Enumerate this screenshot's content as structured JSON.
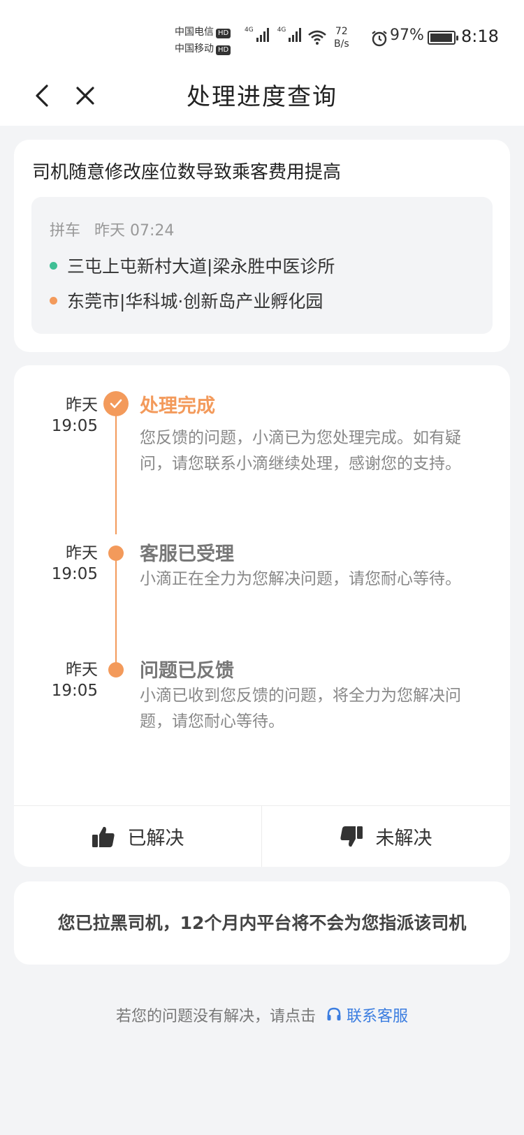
{
  "status_bar": {
    "carrier1": "中国电信",
    "carrier2": "中国移动",
    "hd": "HD",
    "network": "4G",
    "net_speed_value": "72",
    "net_speed_unit": "B/s",
    "battery_pct": "97%",
    "time": "8:18",
    "battery_level": 0.97
  },
  "nav": {
    "title": "处理进度查询",
    "back_icon": "chevron-left-icon",
    "close_icon": "close-icon"
  },
  "order": {
    "title": "司机随意修改座位数导致乘客费用提高",
    "type": "拼车",
    "time": "昨天 07:24",
    "start": "三屯上屯新村大道|梁永胜中医诊所",
    "end": "东莞市|华科城·创新岛产业孵化园",
    "start_color": "#3fbf95",
    "end_color": "#f39a5b"
  },
  "timeline": [
    {
      "day": "昨天",
      "time": "19:05",
      "title": "处理完成",
      "desc": "您反馈的问题，小滴已为您处理完成。如有疑问，请您联系小滴继续处理，感谢您的支持。"
    },
    {
      "day": "昨天",
      "time": "19:05",
      "title": "客服已受理",
      "desc": "小滴正在全力为您解决问题，请您耐心等待。"
    },
    {
      "day": "昨天",
      "time": "19:05",
      "title": "问题已反馈",
      "desc": "小滴已收到您反馈的问题，将全力为您解决问题，请您耐心等待。"
    }
  ],
  "feedback": {
    "solved_label": "已解决",
    "unsolved_label": "未解决"
  },
  "notice": {
    "text": "您已拉黑司机，12个月内平台将不会为您指派该司机"
  },
  "footer": {
    "prompt": "若您的问题没有解决，请点击",
    "link_label": "联系客服"
  },
  "colors": {
    "accent": "#f39a5b",
    "link": "#3b7de0"
  }
}
